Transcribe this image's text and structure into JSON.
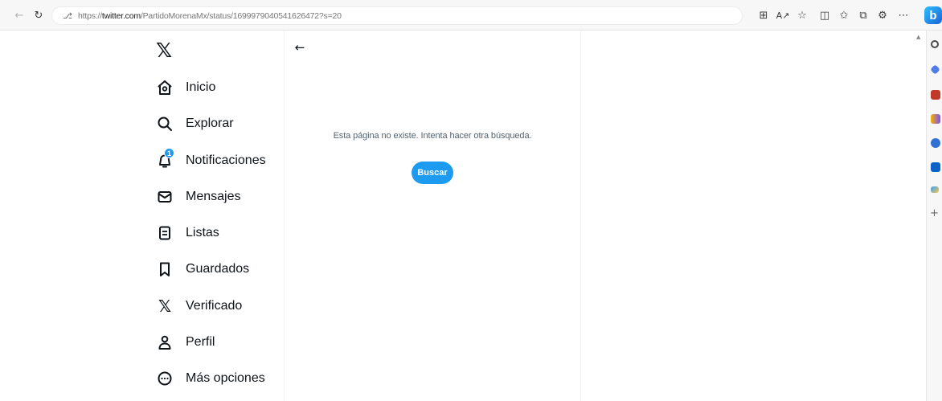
{
  "browser": {
    "url_scheme": "https://",
    "url_host": "twitter.com",
    "url_path": "/PartidoMorenaMx/status/1699979040541626472?s=20"
  },
  "nav": {
    "items": [
      {
        "label": "Inicio",
        "icon": "home-icon"
      },
      {
        "label": "Explorar",
        "icon": "search-icon"
      },
      {
        "label": "Notificaciones",
        "icon": "bell-icon",
        "badge": "1"
      },
      {
        "label": "Mensajes",
        "icon": "envelope-icon"
      },
      {
        "label": "Listas",
        "icon": "list-icon"
      },
      {
        "label": "Guardados",
        "icon": "bookmark-icon"
      },
      {
        "label": "Verificado",
        "icon": "x-logo-icon"
      },
      {
        "label": "Perfil",
        "icon": "person-icon"
      },
      {
        "label": "Más opciones",
        "icon": "more-circle-icon"
      }
    ]
  },
  "main": {
    "error_message": "Esta página no existe. Intenta hacer otra búsqueda.",
    "search_button_label": "Buscar"
  },
  "colors": {
    "accent": "#1d9bf0",
    "text_primary": "#0f1419",
    "text_secondary": "#536471"
  }
}
